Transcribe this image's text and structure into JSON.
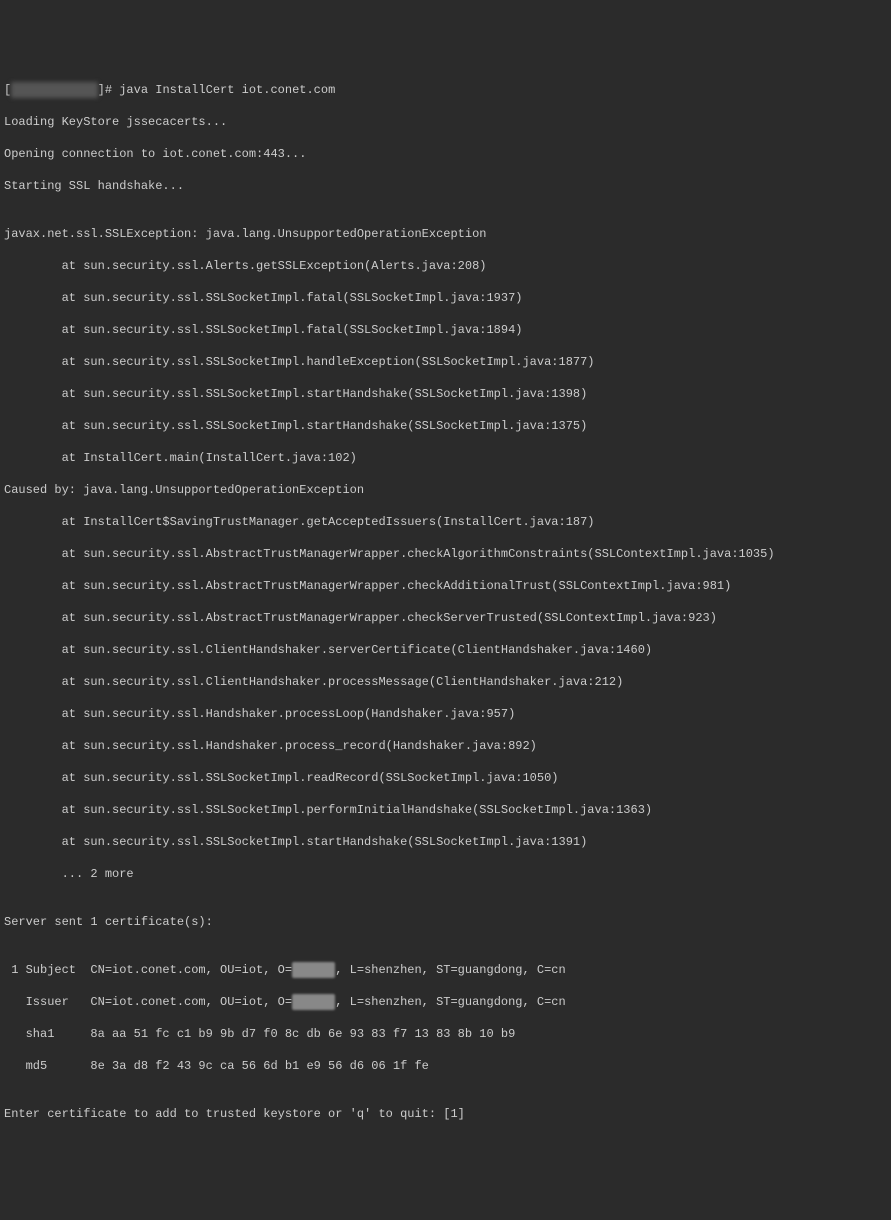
{
  "prompt_prefix": "[",
  "prompt_user_host": "redactedhost",
  "prompt_suffix": "]# ",
  "command": "java InstallCert iot.conet.com",
  "lines": {
    "l1": "Loading KeyStore jssecacerts...",
    "l2": "Opening connection to iot.conet.com:443...",
    "l3": "Starting SSL handshake...",
    "l4": "",
    "l5": "javax.net.ssl.SSLException: java.lang.UnsupportedOperationException",
    "l6": "        at sun.security.ssl.Alerts.getSSLException(Alerts.java:208)",
    "l7": "        at sun.security.ssl.SSLSocketImpl.fatal(SSLSocketImpl.java:1937)",
    "l8": "        at sun.security.ssl.SSLSocketImpl.fatal(SSLSocketImpl.java:1894)",
    "l9": "        at sun.security.ssl.SSLSocketImpl.handleException(SSLSocketImpl.java:1877)",
    "l10": "        at sun.security.ssl.SSLSocketImpl.startHandshake(SSLSocketImpl.java:1398)",
    "l11": "        at sun.security.ssl.SSLSocketImpl.startHandshake(SSLSocketImpl.java:1375)",
    "l12": "        at InstallCert.main(InstallCert.java:102)",
    "l13": "Caused by: java.lang.UnsupportedOperationException",
    "l14": "        at InstallCert$SavingTrustManager.getAcceptedIssuers(InstallCert.java:187)",
    "l15": "        at sun.security.ssl.AbstractTrustManagerWrapper.checkAlgorithmConstraints(SSLContextImpl.java:1035)",
    "l16": "        at sun.security.ssl.AbstractTrustManagerWrapper.checkAdditionalTrust(SSLContextImpl.java:981)",
    "l17": "        at sun.security.ssl.AbstractTrustManagerWrapper.checkServerTrusted(SSLContextImpl.java:923)",
    "l18": "        at sun.security.ssl.ClientHandshaker.serverCertificate(ClientHandshaker.java:1460)",
    "l19": "        at sun.security.ssl.ClientHandshaker.processMessage(ClientHandshaker.java:212)",
    "l20": "        at sun.security.ssl.Handshaker.processLoop(Handshaker.java:957)",
    "l21": "        at sun.security.ssl.Handshaker.process_record(Handshaker.java:892)",
    "l22": "        at sun.security.ssl.SSLSocketImpl.readRecord(SSLSocketImpl.java:1050)",
    "l23": "        at sun.security.ssl.SSLSocketImpl.performInitialHandshake(SSLSocketImpl.java:1363)",
    "l24": "        at sun.security.ssl.SSLSocketImpl.startHandshake(SSLSocketImpl.java:1391)",
    "l25": "        ... 2 more",
    "l26": "",
    "l27": "Server sent 1 certificate(s):",
    "l28": "",
    "sub_prefix": " 1 Subject  CN=iot.conet.com, OU=iot, O=",
    "sub_o": "redact",
    "sub_suffix": ", L=shenzhen, ST=guangdong, C=cn",
    "iss_prefix": "   Issuer   CN=iot.conet.com, OU=iot, O=",
    "iss_o": "redact",
    "iss_suffix": ", L=shenzhen, ST=guangdong, C=cn",
    "l31": "   sha1     8a aa 51 fc c1 b9 9b d7 f0 8c db 6e 93 83 f7 13 83 8b 10 b9",
    "l32": "   md5      8e 3a d8 f2 43 9c ca 56 6d b1 e9 56 d6 06 1f fe",
    "l33": "",
    "l34": "Enter certificate to add to trusted keystore or 'q' to quit: [1]"
  }
}
